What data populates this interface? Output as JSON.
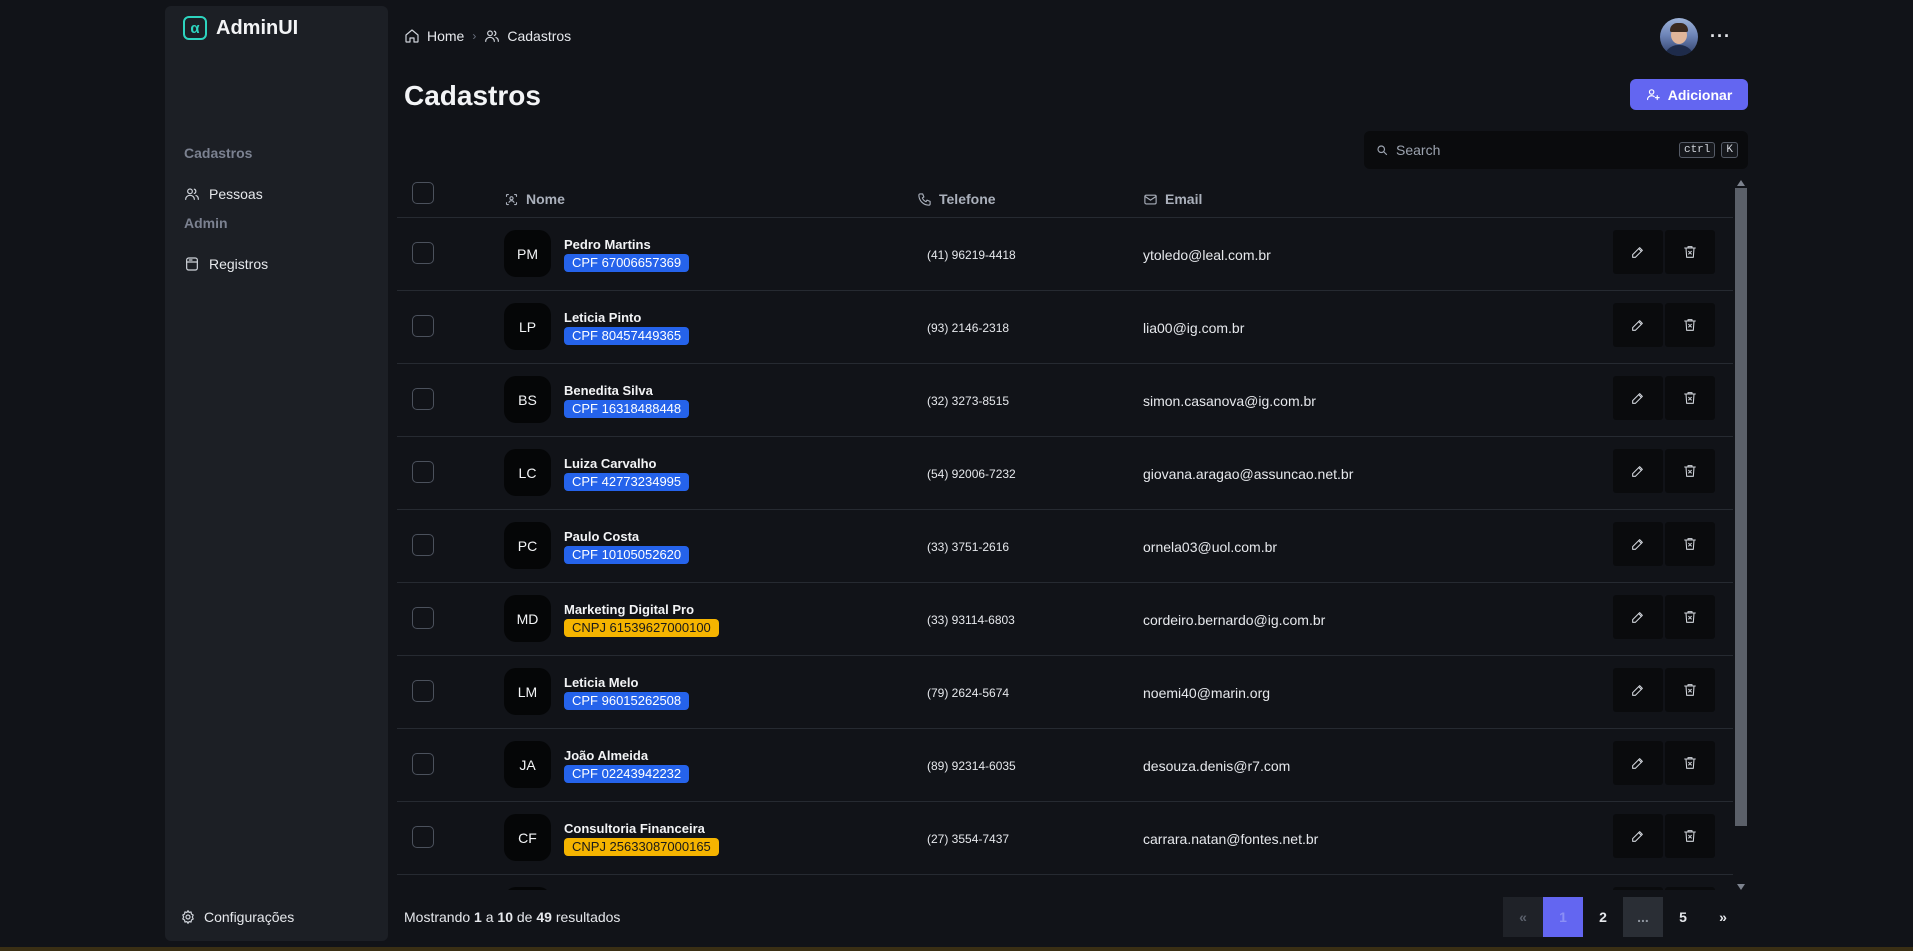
{
  "brand": {
    "name": "AdminUI",
    "logo_glyph": "α"
  },
  "sidebar": {
    "sections": [
      {
        "title": "Cadastros",
        "items": [
          {
            "label": "Pessoas",
            "icon": "users-icon"
          }
        ]
      },
      {
        "title": "Admin",
        "items": [
          {
            "label": "Registros",
            "icon": "database-icon"
          }
        ]
      }
    ],
    "settings_label": "Configurações"
  },
  "breadcrumb": {
    "home": "Home",
    "current": "Cadastros"
  },
  "header": {
    "more": "···"
  },
  "page": {
    "title": "Cadastros",
    "add_label": "Adicionar"
  },
  "search": {
    "placeholder": "Search",
    "kbd_ctrl": "ctrl",
    "kbd_key": "K"
  },
  "table": {
    "columns": {
      "name": "Nome",
      "phone": "Telefone",
      "email": "Email"
    },
    "rows": [
      {
        "initials": "PM",
        "name": "Pedro Martins",
        "doc": "CPF 67006657369",
        "doc_type": "cpf",
        "phone": "(41) 96219-4418",
        "email": "ytoledo@leal.com.br"
      },
      {
        "initials": "LP",
        "name": "Leticia Pinto",
        "doc": "CPF 80457449365",
        "doc_type": "cpf",
        "phone": "(93) 2146-2318",
        "email": "lia00@ig.com.br"
      },
      {
        "initials": "BS",
        "name": "Benedita Silva",
        "doc": "CPF 16318488448",
        "doc_type": "cpf",
        "phone": "(32) 3273-8515",
        "email": "simon.casanova@ig.com.br"
      },
      {
        "initials": "LC",
        "name": "Luiza Carvalho",
        "doc": "CPF 42773234995",
        "doc_type": "cpf",
        "phone": "(54) 92006-7232",
        "email": "giovana.aragao@assuncao.net.br"
      },
      {
        "initials": "PC",
        "name": "Paulo Costa",
        "doc": "CPF 10105052620",
        "doc_type": "cpf",
        "phone": "(33) 3751-2616",
        "email": "ornela03@uol.com.br"
      },
      {
        "initials": "MD",
        "name": "Marketing Digital Pro",
        "doc": "CNPJ 61539627000100",
        "doc_type": "cnpj",
        "phone": "(33) 93114-6803",
        "email": "cordeiro.bernardo@ig.com.br"
      },
      {
        "initials": "LM",
        "name": "Leticia Melo",
        "doc": "CPF 96015262508",
        "doc_type": "cpf",
        "phone": "(79) 2624-5674",
        "email": "noemi40@marin.org"
      },
      {
        "initials": "JA",
        "name": "João Almeida",
        "doc": "CPF 02243942232",
        "doc_type": "cpf",
        "phone": "(89) 92314-6035",
        "email": "desouza.denis@r7.com"
      },
      {
        "initials": "CF",
        "name": "Consultoria Financeira",
        "doc": "CNPJ 25633087000165",
        "doc_type": "cnpj",
        "phone": "(27) 3554-7437",
        "email": "carrara.natan@fontes.net.br"
      },
      {
        "initials": "",
        "name": "",
        "doc": "",
        "doc_type": "",
        "phone": "",
        "email": ""
      }
    ]
  },
  "footer": {
    "results_prefix": "Mostrando",
    "from": "1",
    "sep_a": "a",
    "to": "10",
    "sep_de": "de",
    "total": "49",
    "results_suffix": "resultados"
  },
  "pagination": {
    "prev": "«",
    "pages": [
      "1",
      "2",
      "...",
      "5"
    ],
    "current": "1",
    "next": "»"
  },
  "colors": {
    "accent": "#6366f1",
    "brand_teal": "#2dd4bf",
    "cpf_badge": "#2563eb",
    "cnpj_badge": "#f5b400"
  }
}
